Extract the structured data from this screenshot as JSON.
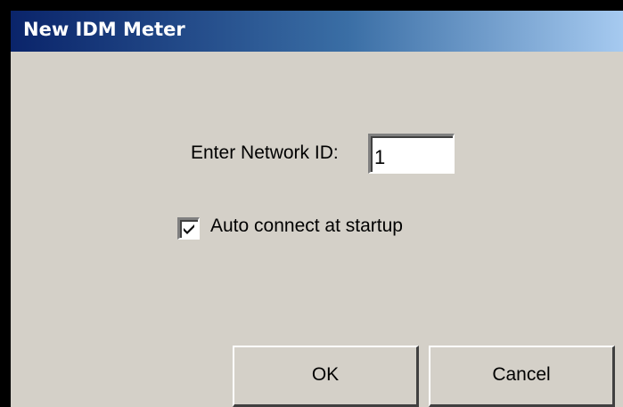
{
  "window": {
    "title": "New IDM Meter"
  },
  "form": {
    "network_id_label": "Enter Network ID:",
    "network_id_value": "1",
    "auto_connect_label": "Auto connect at startup",
    "auto_connect_checked": true
  },
  "buttons": {
    "ok_label": "OK",
    "cancel_label": "Cancel"
  },
  "colors": {
    "title_bar_start": "#0a246a",
    "title_bar_end": "#a6caf0",
    "dialog_background": "#d4d0c8"
  },
  "icons": {
    "checkbox_mark": "checkmark-icon"
  }
}
